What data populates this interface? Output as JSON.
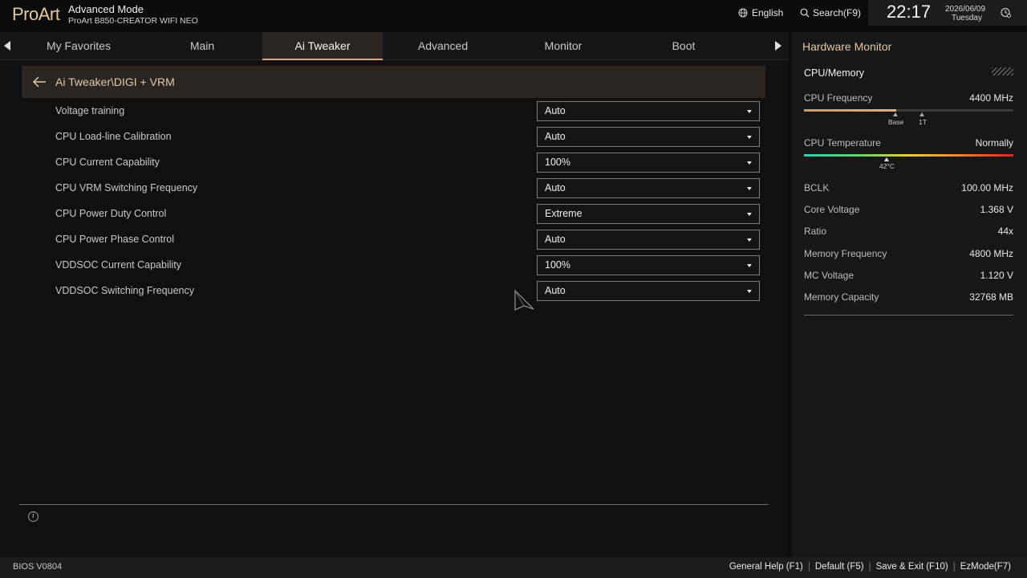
{
  "header": {
    "logo": "ProArt",
    "mode": "Advanced Mode",
    "model": "ProArt B850-CREATOR WIFI NEO",
    "language": "English",
    "search": "Search(F9)",
    "time": "22:17",
    "date": "2026/06/09",
    "day": "Tuesday"
  },
  "tabs": [
    {
      "label": "My Favorites"
    },
    {
      "label": "Main"
    },
    {
      "label": "Ai Tweaker"
    },
    {
      "label": "Advanced"
    },
    {
      "label": "Monitor"
    },
    {
      "label": "Boot"
    }
  ],
  "active_tab": "Ai Tweaker",
  "breadcrumb": "Ai Tweaker\\DIGI + VRM",
  "settings": [
    {
      "label": "Voltage training",
      "value": "Auto"
    },
    {
      "label": "CPU Load-line Calibration",
      "value": "Auto"
    },
    {
      "label": "CPU Current Capability",
      "value": "100%"
    },
    {
      "label": "CPU VRM Switching Frequency",
      "value": "Auto"
    },
    {
      "label": "CPU Power Duty Control",
      "value": "Extreme"
    },
    {
      "label": "CPU Power Phase Control",
      "value": "Auto"
    },
    {
      "label": "VDDSOC Current Capability",
      "value": "100%"
    },
    {
      "label": "VDDSOC Switching Frequency",
      "value": "Auto"
    }
  ],
  "hw_monitor": {
    "title": "Hardware Monitor",
    "section": "CPU/Memory",
    "cpu_frequency": {
      "label": "CPU Frequency",
      "value": "4400 MHz",
      "base_label": "Base",
      "turbo_label": "1T",
      "fill_fraction": 0.44
    },
    "cpu_temperature": {
      "label": "CPU Temperature",
      "value": "Normally",
      "marker_label": "42°C"
    },
    "stats": [
      {
        "label": "BCLK",
        "value": "100.00 MHz"
      },
      {
        "label": "Core Voltage",
        "value": "1.368 V"
      },
      {
        "label": "Ratio",
        "value": "44x"
      },
      {
        "label": "Memory Frequency",
        "value": "4800 MHz"
      },
      {
        "label": "MC Voltage",
        "value": "1.120 V"
      },
      {
        "label": "Memory Capacity",
        "value": "32768 MB"
      }
    ]
  },
  "footer": {
    "bios_version": "BIOS V0804",
    "keys": [
      "General Help (F1)",
      "Default (F5)",
      "Save & Exit (F10)",
      "EzMode(F7)"
    ]
  },
  "colors": {
    "accent": "#e3c7a3",
    "active_tab_bg": "#2a2520",
    "background": "#101010"
  }
}
